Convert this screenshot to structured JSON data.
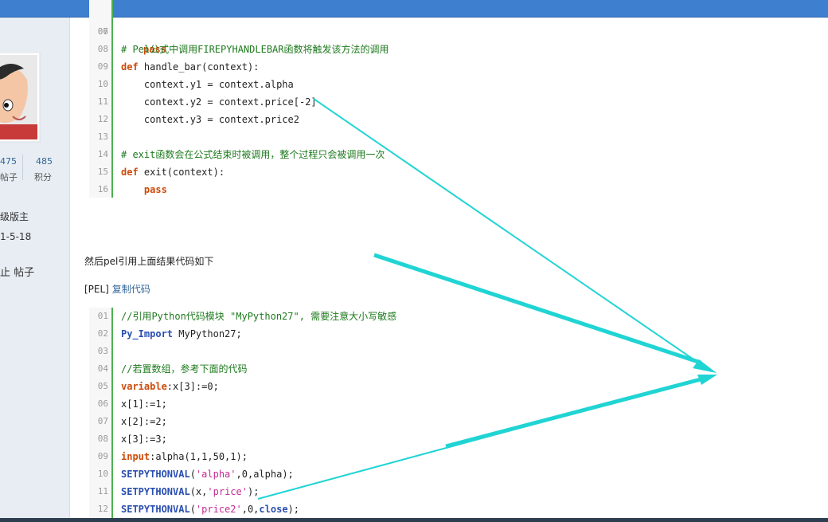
{
  "sidebar": {
    "stats": [
      {
        "value": "475",
        "label": "帖子"
      },
      {
        "value": "485",
        "label": "积分"
      }
    ],
    "role": "级版主",
    "date": "1-5-18",
    "ban": "止 帖子"
  },
  "code1": {
    "top_partial_pass": "pass",
    "lines": [
      {
        "n": "07",
        "tokens": []
      },
      {
        "n": "08",
        "tokens": [
          {
            "t": "# Pel公式中调用FIREPYHANDLEBAR函数将触发该方法的调用",
            "c": "cmt"
          }
        ]
      },
      {
        "n": "09",
        "tokens": [
          {
            "t": "def",
            "c": "kw"
          },
          {
            "t": " handle_bar(context):",
            "c": ""
          }
        ]
      },
      {
        "n": "10",
        "tokens": [
          {
            "t": "    context.y1 = context.alpha",
            "c": ""
          }
        ]
      },
      {
        "n": "11",
        "tokens": [
          {
            "t": "    context.y2 = context.price[-2]",
            "c": ""
          }
        ]
      },
      {
        "n": "12",
        "tokens": [
          {
            "t": "    context.y3 = context.price2",
            "c": ""
          }
        ]
      },
      {
        "n": "13",
        "tokens": []
      },
      {
        "n": "14",
        "tokens": [
          {
            "t": "# exit函数会在公式结束时被调用，整个过程只会被调用一次",
            "c": "cmt"
          }
        ]
      },
      {
        "n": "15",
        "tokens": [
          {
            "t": "def",
            "c": "kw"
          },
          {
            "t": " exit(context):",
            "c": ""
          }
        ]
      },
      {
        "n": "16",
        "tokens": [
          {
            "t": "    ",
            "c": ""
          },
          {
            "t": "pass",
            "c": "kw"
          }
        ]
      }
    ],
    "first_ln": "06"
  },
  "paragraph": "然后pel引用上面结果代码如下",
  "pel_label": "[PEL]",
  "copy_link": "复制代码",
  "code2": {
    "lines": [
      {
        "n": "01",
        "tokens": [
          {
            "t": "//引用Python代码模块 \"MyPython27\", 需要注意大小写敏感",
            "c": "cmt"
          }
        ]
      },
      {
        "n": "02",
        "tokens": [
          {
            "t": "Py_Import",
            "c": "fn"
          },
          {
            "t": " MyPython27;",
            "c": ""
          }
        ]
      },
      {
        "n": "03",
        "tokens": []
      },
      {
        "n": "04",
        "tokens": [
          {
            "t": "//若置数组，参考下面的代码",
            "c": "cmt"
          }
        ]
      },
      {
        "n": "05",
        "tokens": [
          {
            "t": "variable",
            "c": "kw"
          },
          {
            "t": ":x[3]:=0;",
            "c": ""
          }
        ]
      },
      {
        "n": "06",
        "tokens": [
          {
            "t": "x[1]:=1;",
            "c": ""
          }
        ]
      },
      {
        "n": "07",
        "tokens": [
          {
            "t": "x[2]:=2;",
            "c": ""
          }
        ]
      },
      {
        "n": "08",
        "tokens": [
          {
            "t": "x[3]:=3;",
            "c": ""
          }
        ]
      },
      {
        "n": "09",
        "tokens": [
          {
            "t": "input",
            "c": "kw"
          },
          {
            "t": ":alpha(1,1,50,1);",
            "c": ""
          }
        ]
      },
      {
        "n": "10",
        "tokens": [
          {
            "t": "SETPYTHONVAL",
            "c": "fn"
          },
          {
            "t": "(",
            "c": ""
          },
          {
            "t": "'alpha'",
            "c": "str"
          },
          {
            "t": ",0,alpha);",
            "c": ""
          }
        ]
      },
      {
        "n": "11",
        "tokens": [
          {
            "t": "SETPYTHONVAL",
            "c": "fn"
          },
          {
            "t": "(x,",
            "c": ""
          },
          {
            "t": "'price'",
            "c": "str"
          },
          {
            "t": ");",
            "c": ""
          }
        ]
      },
      {
        "n": "12",
        "tokens": [
          {
            "t": "SETPYTHONVAL",
            "c": "fn"
          },
          {
            "t": "(",
            "c": ""
          },
          {
            "t": "'price2'",
            "c": "str"
          },
          {
            "t": ",0,",
            "c": ""
          },
          {
            "t": "close",
            "c": "fn"
          },
          {
            "t": ");",
            "c": ""
          }
        ]
      }
    ]
  },
  "colors": {
    "topbar": "#3f7fcf",
    "arrow": "#21d4d4"
  }
}
